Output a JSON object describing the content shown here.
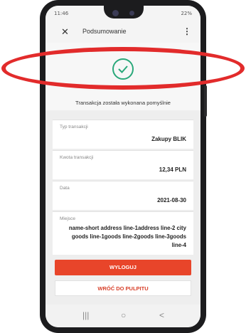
{
  "status_bar": {
    "time": "11:46",
    "right": "22%"
  },
  "header": {
    "close_icon": "close-icon",
    "title": "Podsumowanie",
    "menu_icon": "more-vertical-icon"
  },
  "success": {
    "icon": "checkmark-circle-icon",
    "message": "Transakcja została wykonana pomyślnie"
  },
  "details": [
    {
      "label": "Typ transakcji",
      "value": "Zakupy BLIK"
    },
    {
      "label": "Kwota transakcji",
      "value": "12,34 PLN"
    },
    {
      "label": "Data",
      "value": "2021-08-30"
    },
    {
      "label": "Miejsce",
      "value": "name-short address line-1address line-2 city goods line-1goods line-2goods line-3goods line-4"
    }
  ],
  "buttons": {
    "logout": "WYLOGUJ",
    "back": "WRÓĆ DO PULPITU"
  },
  "nav_bar": {
    "recents": "|||",
    "home": "○",
    "back": "<"
  },
  "colors": {
    "accent": "#e8452a",
    "success": "#2aa87a",
    "annotation": "#e22b2b"
  }
}
